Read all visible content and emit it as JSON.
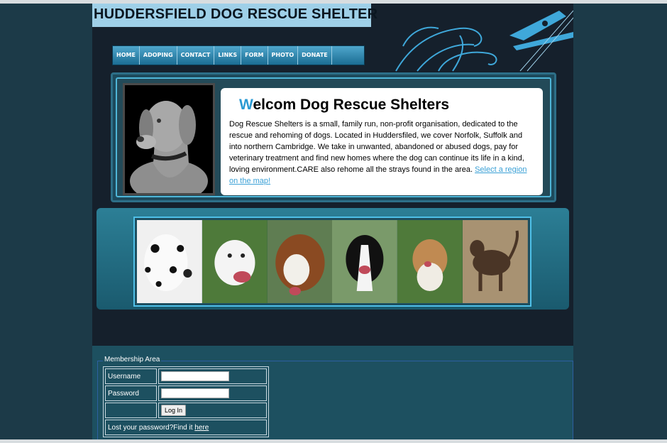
{
  "header": {
    "site_title": "HUDDERSFIELD DOG RESCUE SHELTER"
  },
  "nav": {
    "items": [
      {
        "label": "HOME"
      },
      {
        "label": "ADOPING"
      },
      {
        "label": "CONTACT"
      },
      {
        "label": "LINKS"
      },
      {
        "label": "FORM"
      },
      {
        "label": "PHOTO"
      },
      {
        "label": "DONATE"
      }
    ]
  },
  "welcome": {
    "title_first_letter": "W",
    "title_rest": "elcom Dog Rescue Shelters",
    "body": "Dog Rescue Shelters is a small, family run, non-profit organisation, dedicated to the rescue and rehoming of dogs. Located in Huddersfiled, we cover Norfolk, Suffolk and into northern Cambridge. We take in unwanted, abandoned or abused dogs, pay for veterinary treatment and find new homes where the dog can continue its life in a kind, loving environment.CARE also rehome all the strays found in the area.",
    "map_link": "Select a region on the map",
    "map_link_suffix": "!"
  },
  "membership": {
    "legend": "Membership Area",
    "username_label": "Username",
    "password_label": "Password",
    "login_button": "Log In",
    "lost_password_text": "Lost your password?Find it",
    "lost_password_link": "here"
  },
  "colors": {
    "accent": "#2a9ad3",
    "nav_bg": "#1b6d93",
    "page_bg": "#15202c",
    "outer_bg": "#1c3a48"
  }
}
